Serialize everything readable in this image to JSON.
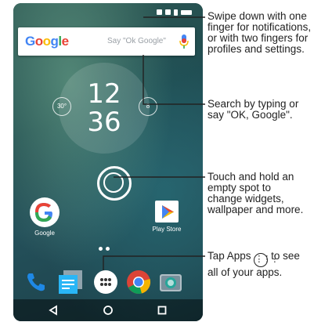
{
  "search": {
    "brand": "Google",
    "placeholder": "Say \"Ok Google\""
  },
  "clock": {
    "hour": "12",
    "minute": "36",
    "temp_left": "30°",
    "temp_right": "8"
  },
  "apps": {
    "google_label": "Google",
    "playstore_label": "Play Store"
  },
  "annotations": {
    "notifications": [
      "Swipe down with one",
      "finger for notifications,",
      "or with two fingers for",
      "profiles and settings."
    ],
    "search": [
      "Search by typing or",
      "say \"OK, Google\"."
    ],
    "touch": [
      "Touch and hold an",
      "empty spot to",
      "change widgets,",
      "wallpaper and more."
    ],
    "apps_line1_a": "Tap Apps",
    "apps_line1_b": "to see",
    "apps_line2": "all of your apps."
  },
  "colors": {
    "google_blue": "#4285F4",
    "google_red": "#EA4335",
    "google_yellow": "#FBBC05",
    "google_green": "#34A853",
    "line": "#222222"
  }
}
